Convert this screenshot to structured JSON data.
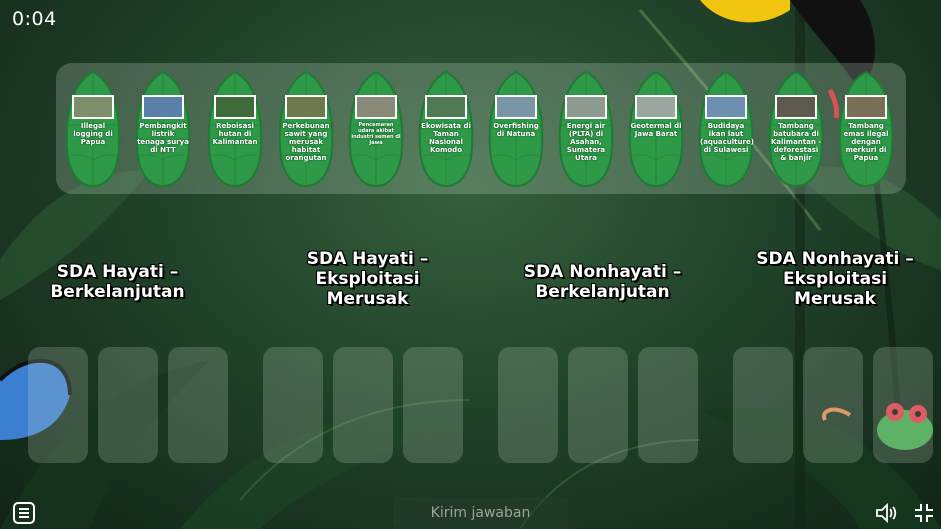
{
  "timer": "0:04",
  "cards": [
    {
      "label": "Illegal logging di Papua",
      "photo": "#7d8f6a"
    },
    {
      "label": "Pembangkit listrik tenaga surya di NTT",
      "photo": "#5a7fa8"
    },
    {
      "label": "Reboisasi hutan di Kalimantan",
      "photo": "#3f6b3a"
    },
    {
      "label": "Perkebunan sawit yang merusak habitat orangutan",
      "photo": "#6e7a4c"
    },
    {
      "label": "Pencemaran udara akibat industri semen di Jawa",
      "photo": "#8a8a78",
      "tiny": true
    },
    {
      "label": "Ekowisata di Taman Nasional Komodo",
      "photo": "#4f7a55"
    },
    {
      "label": "Overfishing di Natuna",
      "photo": "#7a95a5"
    },
    {
      "label": "Energi air (PLTA) di Asahan, Sumatera Utara",
      "photo": "#8c9a90"
    },
    {
      "label": "Geotermal di Jawa Barat",
      "photo": "#9aa6a0"
    },
    {
      "label": "Budidaya ikan laut (aquaculture) di Sulawesi",
      "photo": "#6d8fb0"
    },
    {
      "label": "Tambang batubara di Kalimantan - deforestasi & banjir",
      "photo": "#5e5a4e"
    },
    {
      "label": "Tambang emas ilegal dengan merkuri di Papua",
      "photo": "#7a6e56"
    }
  ],
  "categories": [
    {
      "label": "SDA Hayati – Berkelanjutan"
    },
    {
      "label": "SDA Hayati – Eksploitasi Merusak"
    },
    {
      "label": "SDA Nonhayati – Berkelanjutan"
    },
    {
      "label": "SDA Nonhayati – Eksploitasi Merusak"
    }
  ],
  "submit_label": "Kirim jawaban",
  "icons": {
    "menu": "menu-icon",
    "sound": "speaker-icon",
    "fullscreen": "exit-fullscreen-icon"
  },
  "colors": {
    "leaf": "#2e9a48",
    "leaf_dark": "#1f7a36",
    "tray": "#dcebdc"
  }
}
